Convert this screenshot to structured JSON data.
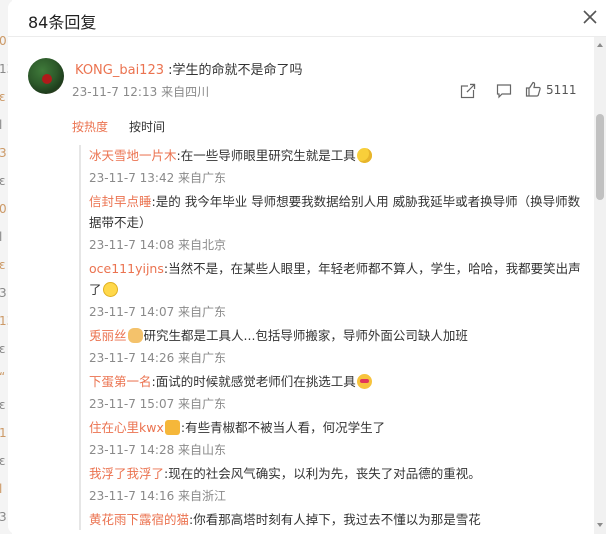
{
  "dialog": {
    "title": "84条回复",
    "close_icon": "close-icon"
  },
  "backdrop_snippets": [
    "0",
    "13",
    "ɛ",
    "l",
    "3",
    "ɛ",
    "0",
    "l",
    "ɛ",
    "3",
    "13",
    "ɛ",
    "“",
    "ɛ",
    "1",
    "ɛ",
    "l",
    "3"
  ],
  "main_comment": {
    "username": "KONG_bai123",
    "text": ":学生的命就不是命了吗",
    "time": "23-11-7 12:13",
    "location": "来自四川",
    "likes": "5111",
    "share_icon": "share-icon",
    "comment_icon": "comment-icon",
    "like_icon": "thumbs-up-icon"
  },
  "sort": {
    "hot": "按热度",
    "time": "按时间"
  },
  "replies": [
    {
      "name": "冰天雪地一片木",
      "text": ":在一些导师眼里研究生就是工具",
      "emoji": "sweat",
      "time": "23-11-7 13:42",
      "location": "来自广东"
    },
    {
      "name": "信封早点睡",
      "text": ":是的 我今年毕业 导师想要我数据给别人用 威胁我延毕或者换导师（换导师数据带不走）",
      "emoji": "",
      "time": "23-11-7 14:08",
      "location": "来自北京"
    },
    {
      "name": "oce111yijns",
      "text": ":当然不是，在某些人眼里，年轻老师都不算人，学生，哈哈，我都要笑出声了",
      "emoji": "grin",
      "time": "23-11-7 14:07",
      "location": "来自广东"
    },
    {
      "name": "兎丽丝",
      "text": "研究生都是工具人...包括导师搬家，导师外面公司缺人加班",
      "emoji": "cat",
      "emoji_first": true,
      "time": "23-11-7 14:26",
      "location": "来自广东"
    },
    {
      "name": "下蛋第一名",
      "text": ":面试的时候就感觉老师们在挑选工具",
      "emoji": "love",
      "time": "23-11-7 15:07",
      "location": "来自广东"
    },
    {
      "name": "住在心里kwx",
      "text": ":有些青椒都不被当人看，何况学生了",
      "emoji": "crown",
      "emoji_first": true,
      "time": "23-11-7 14:28",
      "location": "来自山东"
    },
    {
      "name": "我浮了我浮了",
      "text": ":现在的社会风气确实，以利为先，丧失了对品德的重视。",
      "emoji": "",
      "time": "23-11-7 14:16",
      "location": "来自浙江"
    },
    {
      "name": "黄花雨下露宿的猫",
      "text": ":你看那高塔时刻有人掉下，我过去不懂以为那是雪花",
      "emoji": "",
      "time": "",
      "location": ""
    }
  ]
}
